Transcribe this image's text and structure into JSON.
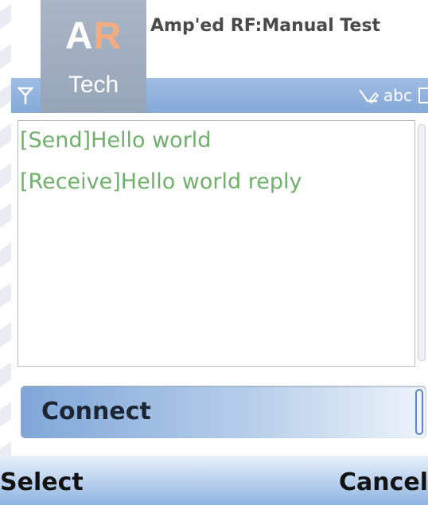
{
  "header": {
    "logo": {
      "letter_a": "A",
      "letter_r": "R",
      "tech": "Tech"
    },
    "title": "Amp'ed RF:Manual Test",
    "status": {
      "input_mode": "abc",
      "signal_icon": "signal-antenna-icon",
      "pen_icon": "pen-icon",
      "battery_icon": "battery-icon"
    }
  },
  "log": {
    "lines": [
      "[Send]Hello world",
      "[Receive]Hello world reply"
    ]
  },
  "connect": {
    "label": "Connect"
  },
  "softkeys": {
    "left": "Select",
    "right": "Cancel"
  },
  "colors": {
    "accent": "#86a9d8",
    "log_text": "#6fb06a",
    "logo_r": "#f4ac7f",
    "logo_bg": "#97a5b9"
  }
}
